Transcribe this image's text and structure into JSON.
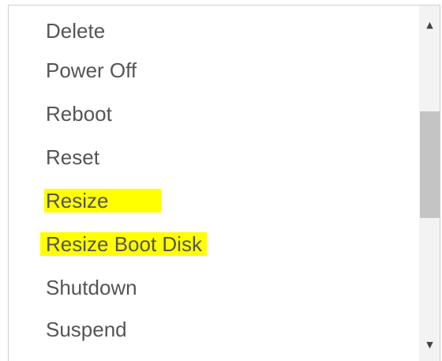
{
  "menu": {
    "items": [
      {
        "label": "Delete",
        "highlighted": false
      },
      {
        "label": "Power Off",
        "highlighted": false
      },
      {
        "label": "Reboot",
        "highlighted": false
      },
      {
        "label": "Reset",
        "highlighted": false
      },
      {
        "label": "Resize",
        "highlighted": true
      },
      {
        "label": "Resize Boot Disk",
        "highlighted": true
      },
      {
        "label": "Shutdown",
        "highlighted": false
      },
      {
        "label": "Suspend",
        "highlighted": false
      }
    ]
  },
  "scrollbar": {
    "up_icon": "triangle-up",
    "down_icon": "triangle-down"
  },
  "colors": {
    "highlight": "#ffff00",
    "text": "#555555",
    "thumb": "#c4c4c4",
    "track": "#f3f3f3"
  }
}
